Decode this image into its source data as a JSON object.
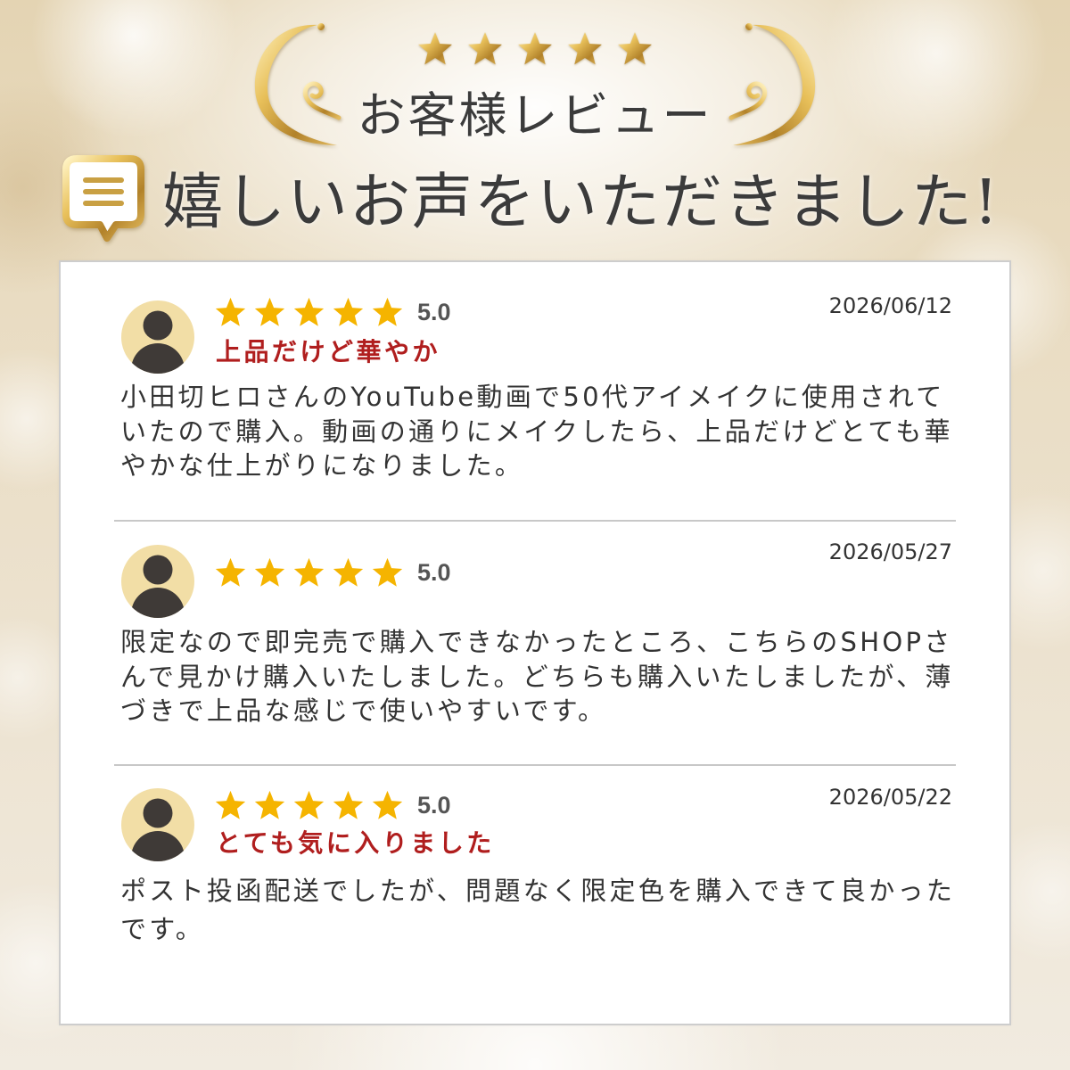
{
  "header": {
    "stars": 5,
    "heading": "お客様レビュー",
    "subheading": "嬉しいお声をいただきました!",
    "decorations": [
      "gold-flourish-left-icon",
      "gold-flourish-right-icon",
      "speech-bubble-icon"
    ]
  },
  "colors": {
    "gold": "#c9a043",
    "heading": "#3b3b3b",
    "text": "#333333",
    "score": "#555555",
    "review_star": "#f5b400",
    "title_red": "#b01e1e",
    "avatar_bg": "#f2dea6",
    "avatar_figure": "#3f3a37",
    "divider": "#c8c8c8",
    "card_bg": "#ffffff"
  },
  "reviews": [
    {
      "avatar": "user-avatar-icon",
      "stars": 5,
      "rating": "5.0",
      "date": "2026/06/12",
      "title": "上品だけど華やか",
      "body_lines": [
        "小田切ヒロさんのYouTube動画で50代アイメイクに使用されて",
        "いたので購入。動画の通りにメイクしたら、上品だけどとても華",
        "やかな仕上がりになりました。"
      ]
    },
    {
      "avatar": "user-avatar-icon",
      "stars": 5,
      "rating": "5.0",
      "date": "2026/05/27",
      "body_lines": [
        "限定なので即完売で購入できなかったところ、こちらのSHOPさ",
        "んで見かけ購入いたしました。どちらも購入いたしましたが、薄",
        "づきで上品な感じで使いやすいです。"
      ]
    },
    {
      "avatar": "user-avatar-icon",
      "stars": 5,
      "rating": "5.0",
      "date": "2026/05/22",
      "title": "とても気に入りました",
      "body_lines": [
        "ポスト投函配送でしたが、問題なく限定色を購入できて良かった",
        "です。"
      ]
    }
  ]
}
